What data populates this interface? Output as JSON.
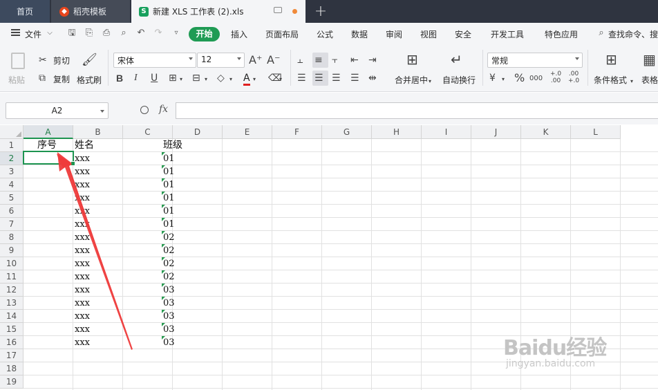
{
  "tabs": {
    "home": "首页",
    "template": "稻壳模板",
    "file": "新建 XLS 工作表 (2).xls",
    "file_icon": "S"
  },
  "menu": {
    "file": "文件",
    "start": "开始",
    "items": [
      "插入",
      "页面布局",
      "公式",
      "数据",
      "审阅",
      "视图",
      "安全",
      "开发工具",
      "特色应用"
    ],
    "search": "查找命令、搜"
  },
  "ribbon": {
    "paste": "粘贴",
    "cut": "剪切",
    "copy": "复制",
    "format_painter": "格式刷",
    "font_name": "宋体",
    "font_size": "12",
    "merge_center": "合并居中",
    "wrap_text": "自动换行",
    "number_format": "常规",
    "conditional_format": "条件格式",
    "table_style": "表格",
    "bold": "B",
    "italic": "I",
    "underline": "U",
    "font_color_letter": "A",
    "percent": "%",
    "currency": "¥",
    "thousands": "000",
    "inc_decimal": "+.0\n.00",
    "dec_decimal": ".00\n+.0"
  },
  "formula_bar": {
    "name_box": "A2",
    "fx": "fx",
    "content": ""
  },
  "sheet": {
    "columns": [
      "A",
      "B",
      "C",
      "D",
      "E",
      "F",
      "G",
      "H",
      "I",
      "J",
      "K",
      "L"
    ],
    "rows": [
      "1",
      "2",
      "3",
      "4",
      "5",
      "6",
      "7",
      "8",
      "9",
      "10",
      "11",
      "12",
      "13",
      "14",
      "15",
      "16",
      "17",
      "18",
      "19"
    ],
    "active_cell": "A2",
    "header_row": [
      "序号",
      "姓名",
      "班级"
    ],
    "data": [
      {
        "name": "xxx",
        "class": "01"
      },
      {
        "name": "xxx",
        "class": "01"
      },
      {
        "name": "xxx",
        "class": "01"
      },
      {
        "name": "xxx",
        "class": "01"
      },
      {
        "name": "xxx",
        "class": "01"
      },
      {
        "name": "xxx",
        "class": "01"
      },
      {
        "name": "xxx",
        "class": "02"
      },
      {
        "name": "xxx",
        "class": "02"
      },
      {
        "name": "xxx",
        "class": "02"
      },
      {
        "name": "xxx",
        "class": "02"
      },
      {
        "name": "xxx",
        "class": "03"
      },
      {
        "name": "xxx",
        "class": "03"
      },
      {
        "name": "xxx",
        "class": "03"
      },
      {
        "name": "xxx",
        "class": "03"
      },
      {
        "name": "xxx",
        "class": "03"
      }
    ]
  },
  "watermark": {
    "logo": "Baidu经验",
    "url": "jingyan.baidu.com"
  },
  "colors": {
    "accent_green": "#1d9450",
    "tabbar_bg": "#2f3440",
    "annotation_arrow": "#ee3b3b"
  }
}
